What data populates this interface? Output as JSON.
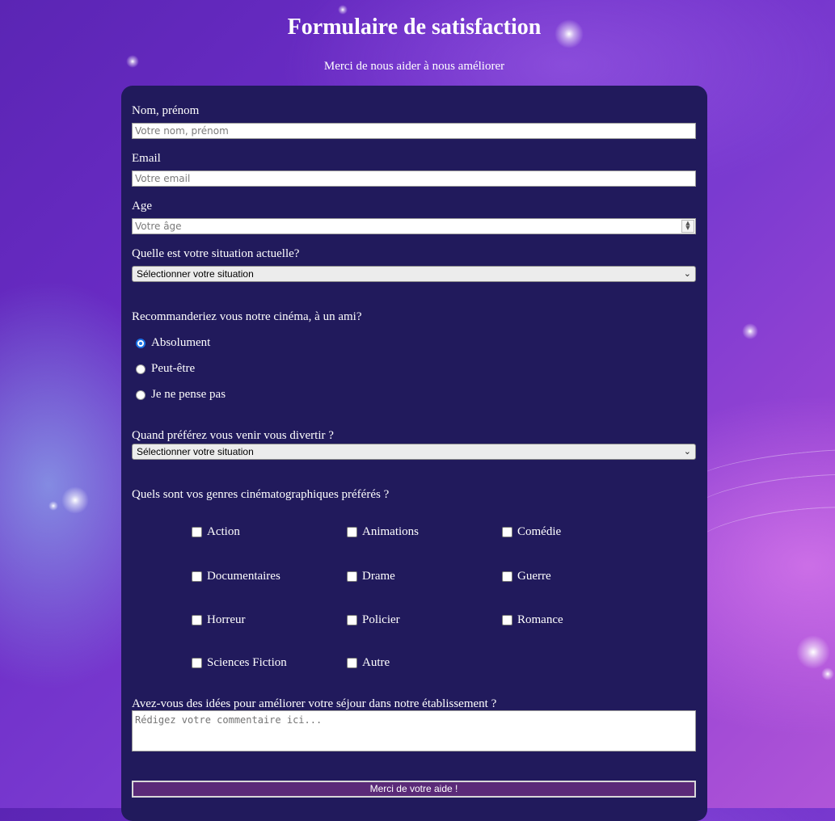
{
  "header": {
    "title": "Formulaire de satisfaction",
    "subtitle": "Merci de nous aider à nous améliorer"
  },
  "form": {
    "name": {
      "label": "Nom, prénom",
      "placeholder": "Votre nom, prénom",
      "value": ""
    },
    "email": {
      "label": "Email",
      "placeholder": "Votre email",
      "value": ""
    },
    "age": {
      "label": "Age",
      "placeholder": "Votre âge",
      "value": ""
    },
    "situation": {
      "label": "Quelle est votre situation actuelle?",
      "selected": "Sélectionner votre situation"
    },
    "recommend": {
      "label": "Recommanderiez vous notre cinéma, à un ami?",
      "options": [
        "Absolument",
        "Peut-être",
        "Je ne pense pas"
      ],
      "checked_index": 0
    },
    "when": {
      "label": "Quand préférez vous venir vous divertir ?",
      "selected": "Sélectionner votre situation"
    },
    "genres": {
      "label": "Quels sont vos genres cinématographiques préférés ?",
      "options": [
        "Action",
        "Animations",
        "Comédie",
        "Documentaires",
        "Drame",
        "Guerre",
        "Horreur",
        "Policier",
        "Romance",
        "Sciences Fiction",
        "Autre"
      ],
      "checked": []
    },
    "ideas": {
      "label": "Avez-vous des idées pour améliorer votre séjour dans notre établissement ?",
      "placeholder": "Rédigez votre commentaire ici..."
    },
    "submit_label": "Merci de votre aide !"
  },
  "colors": {
    "card": "#211a5c",
    "submit_bg": "#5a2a78",
    "radio_accent": "#1a73e8"
  }
}
